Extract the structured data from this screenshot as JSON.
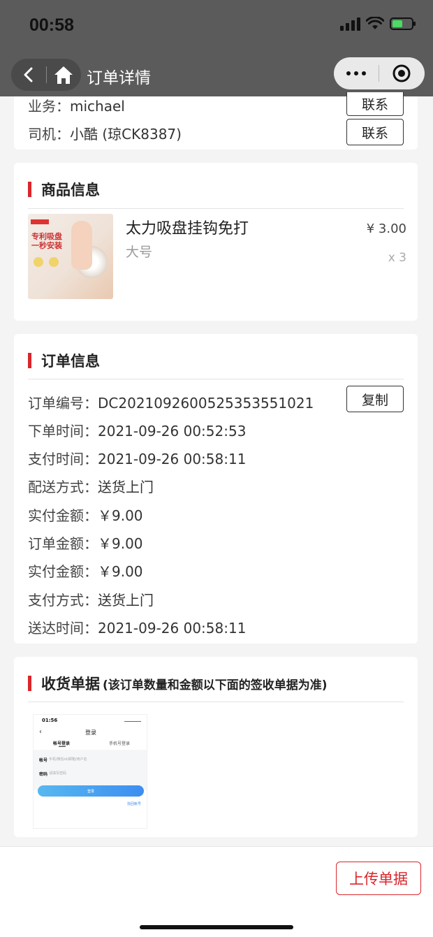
{
  "status_bar": {
    "time": "00:58"
  },
  "nav": {
    "title": "订单详情"
  },
  "contacts": {
    "sales_label": "业务：",
    "sales_name": "michael",
    "driver_label": "司机：",
    "driver_name": "小酷 (琼CK8387)",
    "contact_button": "联系"
  },
  "product_section": {
    "title": "商品信息",
    "product": {
      "name": "太力吸盘挂钩免打",
      "spec": "大号",
      "price": "¥ 3.00",
      "quantity": "x 3",
      "image_text_line1": "专利吸盘",
      "image_text_line2": "一秒安装"
    }
  },
  "order_section": {
    "title": "订单信息",
    "copy_button": "复制",
    "rows": [
      {
        "label": "订单编号：",
        "value": "DC20210926005253535510​21"
      },
      {
        "label": "下单时间：",
        "value": "2021-09-26 00:52:53"
      },
      {
        "label": "支付时间：",
        "value": "2021-09-26 00:58:11"
      },
      {
        "label": "配送方式：",
        "value": "送货上门"
      },
      {
        "label": "实付金额：",
        "value": "￥9.00"
      },
      {
        "label": "订单金额：",
        "value": "￥9.00"
      },
      {
        "label": "实付金额：",
        "value": "￥9.00"
      },
      {
        "label": "支付方式：",
        "value": "送货上门"
      },
      {
        "label": "送达时间：",
        "value": "2021-09-26 00:58:11"
      }
    ]
  },
  "receipt_section": {
    "title": "收货单据",
    "subtitle": "(该订单数量和金额以下面的签收单据为准)",
    "thumbnail": {
      "time": "01:56",
      "title": "登录",
      "tab_account": "帐号登录",
      "tab_phone": "手机号登录",
      "account_label": "帐号",
      "account_placeholder": "手机/微信id/邮箱/用户名",
      "password_label": "密码",
      "password_placeholder": "请填写密码",
      "login_button": "登录",
      "forgot_link": "找回帐号"
    }
  },
  "footer": {
    "upload_button": "上传单据"
  },
  "colors": {
    "accent": "#d9262c",
    "nav_bg": "#5b5b5b",
    "page_bg": "#f4f4f4"
  }
}
